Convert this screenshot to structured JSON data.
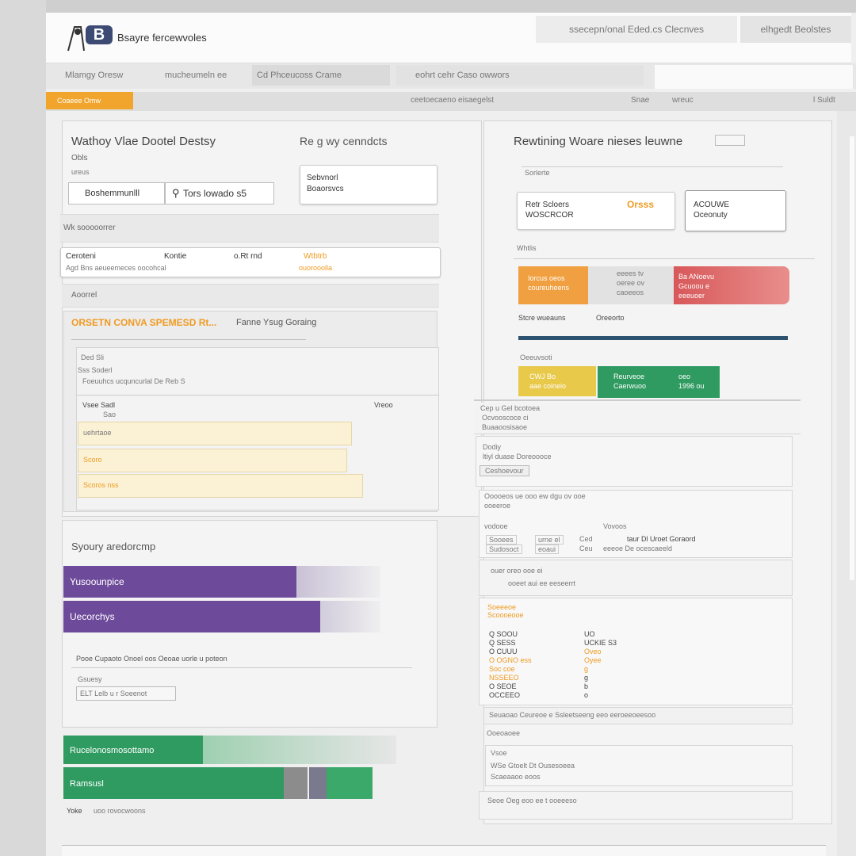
{
  "header": {
    "brand": "Bsayre fercewvoles",
    "link_primary": "ssecepn/onal Eded.cs Clecnves",
    "link_secondary": "elhgedt Beolstes"
  },
  "menu": {
    "items": [
      "Mlamgy Oresw",
      "mucheumeln ee",
      "Cd Phceucoss Crame",
      "eohrt cehr Caso owwors"
    ]
  },
  "toolbar": {
    "badge": "Coaeee  Omw",
    "center": "ceetoecaeno eisaegelst",
    "right_a": "Snae",
    "right_b": "wreuc",
    "far_right": "l Suldt"
  },
  "left": {
    "title": "Wathoy Vlae Dootel Destsy",
    "subtitle": "Obls",
    "tiny": "ureus",
    "input_label": "Boshemmunlll",
    "input_value": "Tors lowado s5",
    "search_title": "Re g wy cenndcts",
    "search_card_l1": "Sebvnorl",
    "search_card_l2": "Boaorsvcs",
    "section_a": "Wk sooooorrer",
    "row": [
      "Ceroteni",
      "Kontie",
      "o.Rt rnd",
      "Wtbtrb"
    ],
    "row_sub": "Agd Bns aeueemeces oocohcal",
    "row_orange_sub": "ouorooolla",
    "section_b": "Aoorrel",
    "orange_heading": "ORSETN CONVA SPEMESD Rt...",
    "orange_heading_right": "Fanne Ysug Goraing",
    "list_head": "Ded Sli",
    "list_sub": "Sss Soderl",
    "list_line": "Foeuuhcs ucquncurlal De Reb S",
    "list_row_l": "Vsee Sadl",
    "list_row_r": "Vreoo",
    "list_row_sub": "Sao",
    "yellow_rows": [
      "uehrtaoe",
      "Scoro",
      "Scoros nss"
    ],
    "panel2_title": "Syoury aredorcmp",
    "purple_bars": [
      "Yusoounpice",
      "Uecorchys"
    ],
    "detail_line": "Pooe Cupaoto Onoel oos   Oeoae uorle u poteon",
    "detail_label": "Gsuesy",
    "detail_box": "ELT Lelb u r Soeenot",
    "green_bars": [
      "Rucelonosmosottamo",
      "Ramsusl"
    ],
    "footer_a": "Yoke",
    "footer_b": "uoo rovocwoons"
  },
  "right": {
    "title": "Rewtining Woare nieses leuwne",
    "tiny": "Sorlerte",
    "card_a_l1": "Retr Scloers",
    "card_a_l2": "WOSCRCOR",
    "card_a_badge": "Orsss",
    "card_b_l1": "ACOUWE",
    "card_b_l2": "Oceonuty",
    "section_a": "Whtlis",
    "orange_tag_l1": "Iorcus oeos",
    "orange_tag_l2": "coureuheens",
    "mid_tag": [
      "eeees tv",
      "oeree ov",
      "caoeeos"
    ],
    "red_tag_l1": "Ba ANoevu",
    "red_tag_l2": "Gcuoou e",
    "red_tag_l3": "eeeuoer",
    "legend": "Stcre wueauns",
    "legend_b": "Oreeorto",
    "section_b": "Oeeuvsoti",
    "yellow_tag": [
      "CWJ Bo",
      "aae coineio"
    ],
    "green_tag": [
      "Reurveoe",
      "Caerwuoo"
    ],
    "green_tag_r": [
      "oeo",
      "1996 ou"
    ],
    "list_a": [
      "Cep u Gel bcotoea",
      "Ocvooscoce ci",
      "Buaaoosisaoe"
    ],
    "list_b": [
      "Dodiy",
      "ltiyl duase Doreoooce"
    ],
    "list_b_btn": "Ceshoevour",
    "list_c": [
      "Ooooeos ue ooo ew dgu ov ooe",
      "ooeeroe",
      "vodooe"
    ],
    "list_c_cols": [
      "Sooees",
      "urne el",
      "Ced",
      "taur Dl Uroet Goraord",
      "Sudosoct",
      "eoaui",
      "Ceu",
      "eeeoe De ocescaeeld"
    ],
    "list_c_right": "Vovoos",
    "list_d": "ouer oreo ooe ei",
    "list_d_sub": "ooeet aui ee eeseerrt",
    "list_e_title": "Soeeeoe",
    "list_e_sub": "Scoooeooe",
    "list_e_left": [
      "Q SOOU",
      "Q SESS",
      "O CUUU",
      "O OGNO ess",
      "Soc coe",
      "NSSEEO",
      "O SEOE",
      "OCCEEO"
    ],
    "list_e_right": [
      "UO",
      "UCKIE S3",
      "Oveo",
      "Oyee",
      "g",
      "g",
      "b",
      "o"
    ],
    "list_f": "Seuaoao  Ceureoe e Ssleetseeng eeo eeroeeoeesoo",
    "list_g": "Ooeoaoee",
    "list_h": [
      "Vsoe",
      "WSe Gtoelt Dt Ousesoeea",
      "Scaeaaoo eoos"
    ],
    "list_i": "Seoe Oeg eoo ee t ooeeeso"
  },
  "colors": {
    "orange": "#f2a52c",
    "red": "#d8585a",
    "purple": "#6d4a9a",
    "green": "#2f9b61",
    "yellow": "#e8c94a",
    "navy": "#2c5270"
  }
}
